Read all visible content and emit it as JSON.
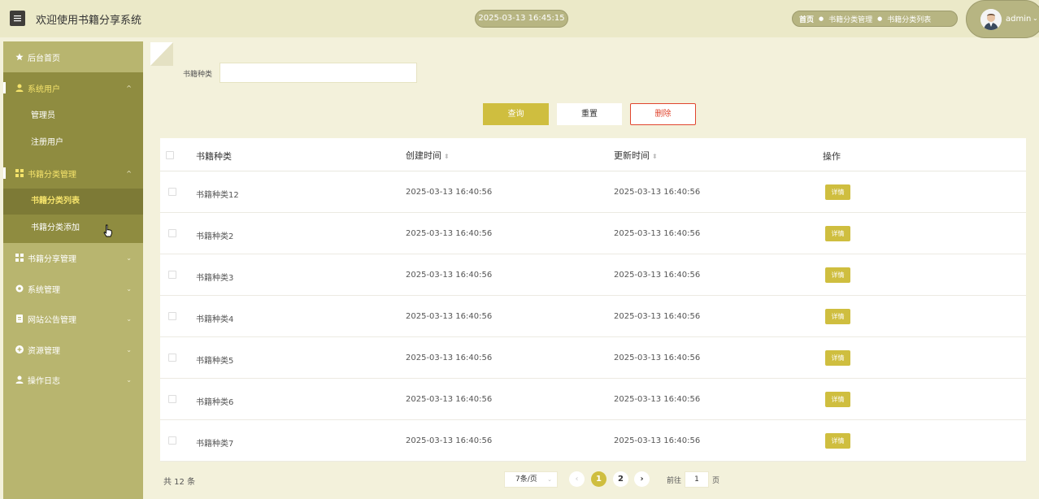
{
  "header": {
    "title": "欢迎使用书籍分享系统",
    "datetime": "2025-03-13 16:45:15",
    "breadcrumb": [
      "首页",
      "书籍分类管理",
      "书籍分类列表"
    ],
    "username": "admin"
  },
  "sidebar": {
    "home": "后台首页",
    "groups": [
      {
        "label": "系统用户",
        "icon": "user-icon",
        "expanded": true,
        "children": [
          "管理员",
          "注册用户"
        ]
      },
      {
        "label": "书籍分类管理",
        "icon": "grid-icon",
        "expanded": true,
        "children": [
          "书籍分类列表",
          "书籍分类添加"
        ],
        "active_child": "书籍分类列表"
      },
      {
        "label": "书籍分享管理",
        "icon": "grid-icon",
        "expanded": false
      },
      {
        "label": "系统管理",
        "icon": "gear-icon",
        "expanded": false
      },
      {
        "label": "网站公告管理",
        "icon": "document-icon",
        "expanded": false
      },
      {
        "label": "资源管理",
        "icon": "plus-circle-icon",
        "expanded": false
      },
      {
        "label": "操作日志",
        "icon": "user-icon",
        "expanded": false
      }
    ]
  },
  "search": {
    "label": "书籍种类",
    "value": "",
    "query_label": "查询",
    "reset_label": "重置",
    "delete_label": "删除"
  },
  "table": {
    "columns": [
      "书籍种类",
      "创建时间",
      "更新时间",
      "操作"
    ],
    "rows": [
      {
        "type": "书籍种类12",
        "created": "2025-03-13 16:40:56",
        "updated": "2025-03-13 16:40:56",
        "action": "详情"
      },
      {
        "type": "书籍种类2",
        "created": "2025-03-13 16:40:56",
        "updated": "2025-03-13 16:40:56",
        "action": "详情"
      },
      {
        "type": "书籍种类3",
        "created": "2025-03-13 16:40:56",
        "updated": "2025-03-13 16:40:56",
        "action": "详情"
      },
      {
        "type": "书籍种类4",
        "created": "2025-03-13 16:40:56",
        "updated": "2025-03-13 16:40:56",
        "action": "详情"
      },
      {
        "type": "书籍种类5",
        "created": "2025-03-13 16:40:56",
        "updated": "2025-03-13 16:40:56",
        "action": "详情"
      },
      {
        "type": "书籍种类6",
        "created": "2025-03-13 16:40:56",
        "updated": "2025-03-13 16:40:56",
        "action": "详情"
      },
      {
        "type": "书籍种类7",
        "created": "2025-03-13 16:40:56",
        "updated": "2025-03-13 16:40:56",
        "action": "详情"
      }
    ]
  },
  "pagination": {
    "total": "共 12 条",
    "page_size": "7条/页",
    "pages": [
      "1",
      "2"
    ],
    "current": "1",
    "goto_label": "前往",
    "goto_value": "1",
    "goto_unit": "页"
  },
  "colors": {
    "accent": "#cfbe3f",
    "sidebar": "#b8b56f",
    "sidebar_open": "#8f8c40",
    "header": "#ebe9c8",
    "danger": "#e0452e"
  }
}
